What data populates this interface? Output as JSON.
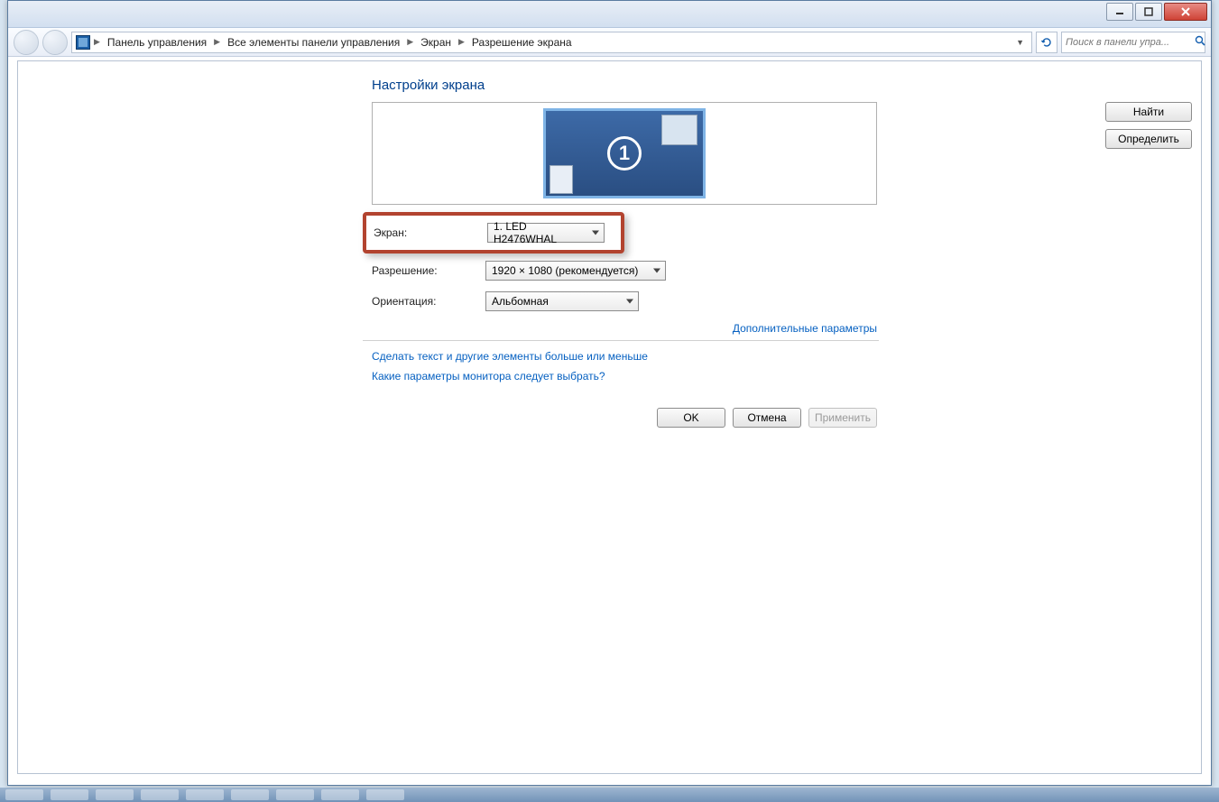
{
  "breadcrumb": {
    "items": [
      "Панель управления",
      "Все элементы панели управления",
      "Экран",
      "Разрешение экрана"
    ]
  },
  "search": {
    "placeholder": "Поиск в панели упра..."
  },
  "page": {
    "title": "Настройки экрана"
  },
  "monitor": {
    "number": "1"
  },
  "buttons": {
    "find": "Найти",
    "identify": "Определить",
    "ok": "OK",
    "cancel": "Отмена",
    "apply": "Применить"
  },
  "form": {
    "screen_label": "Экран:",
    "screen_value": "1. LED H2476WHAL",
    "resolution_label": "Разрешение:",
    "resolution_value": "1920 × 1080 (рекомендуется)",
    "orientation_label": "Ориентация:",
    "orientation_value": "Альбомная"
  },
  "links": {
    "advanced": "Дополнительные параметры",
    "text_size": "Сделать текст и другие элементы больше или меньше",
    "which_settings": "Какие параметры монитора следует выбрать?"
  }
}
